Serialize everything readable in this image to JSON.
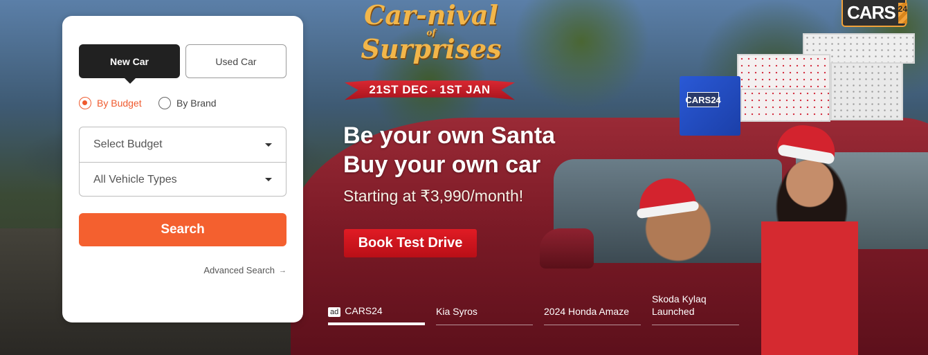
{
  "search_card": {
    "tabs": [
      {
        "label": "New Car",
        "active": true
      },
      {
        "label": "Used Car",
        "active": false
      }
    ],
    "radio_options": [
      {
        "label": "By Budget",
        "selected": true
      },
      {
        "label": "By Brand",
        "selected": false
      }
    ],
    "budget_select": {
      "value": "Select Budget"
    },
    "vehicle_type_select": {
      "value": "All Vehicle Types"
    },
    "search_label": "Search",
    "advanced_search_label": "Advanced Search",
    "accent_color": "#f4602f"
  },
  "banner": {
    "campaign_line1": "Car-nival",
    "campaign_of": "of",
    "campaign_line2": "Surprises",
    "dates": "21ST DEC - 1ST JAN",
    "headline_line1": "Be your own Santa",
    "headline_line2": "Buy your own car",
    "subline": "Starting at ₹3,990/month!",
    "cta_label": "Book Test Drive",
    "bag_logo": "CARS24"
  },
  "brand": {
    "name": "CARS",
    "number": "24"
  },
  "slider_tabs": [
    {
      "badge": "ad",
      "label": "CARS24",
      "active": true
    },
    {
      "badge": "",
      "label": "Kia Syros",
      "active": false
    },
    {
      "badge": "",
      "label": "2024 Honda Amaze",
      "active": false
    },
    {
      "badge": "",
      "label": "Skoda Kylaq Launched",
      "active": false
    }
  ]
}
